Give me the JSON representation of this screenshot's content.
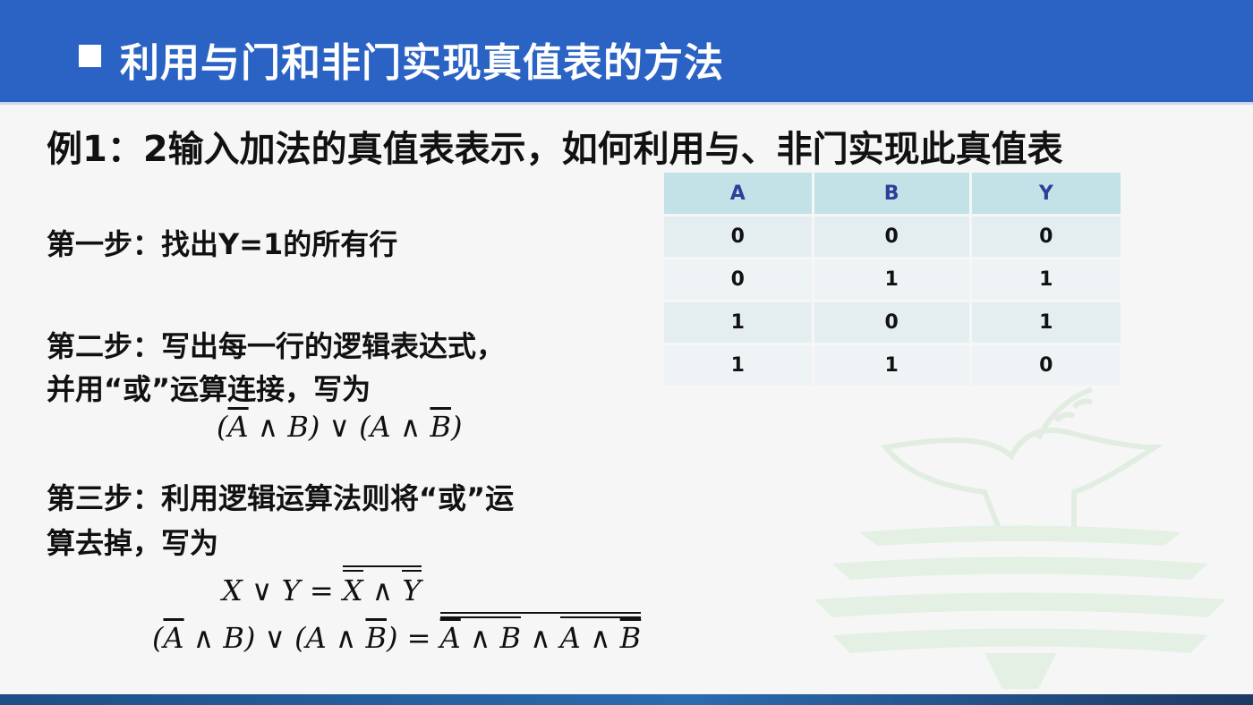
{
  "header": {
    "title": "利用与门和非门实现真值表的方法"
  },
  "example": {
    "text": "例1：2输入加法的真值表表示，如何利用与、非门实现此真值表"
  },
  "steps": {
    "step1": "第一步：找出Y=1的所有行",
    "step2_line1": "第二步：写出每一行的逻辑表达式，",
    "step2_line2": "并用“或”运算连接，写为",
    "step3_line1": "第三步：利用逻辑运算法则将“或”运",
    "step3_line2": "算去掉，写为"
  },
  "truth_table": {
    "headers": [
      "A",
      "B",
      "Y"
    ],
    "rows": [
      [
        "0",
        "0",
        "0"
      ],
      [
        "0",
        "1",
        "1"
      ],
      [
        "1",
        "0",
        "1"
      ],
      [
        "1",
        "1",
        "0"
      ]
    ]
  },
  "colors": {
    "header_bg": "#2b63c4",
    "table_header_bg": "#c3e2e8",
    "table_header_text": "#2c3f9a"
  }
}
